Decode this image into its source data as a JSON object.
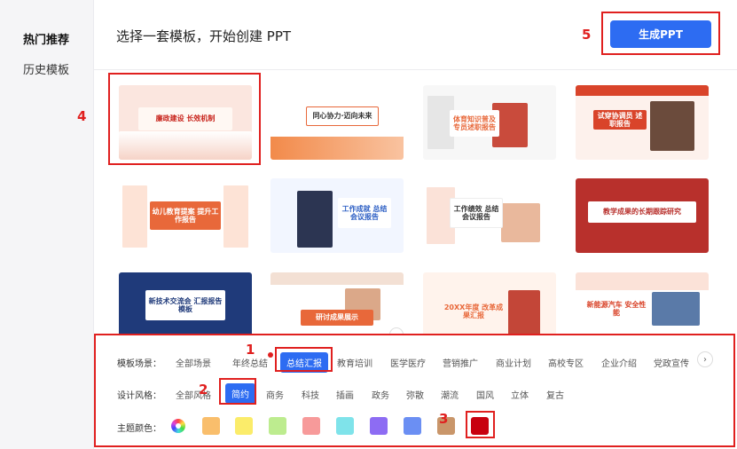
{
  "sidebar": {
    "items": [
      {
        "label": "热门推荐",
        "active": true
      },
      {
        "label": "历史模板",
        "active": false
      }
    ]
  },
  "header": {
    "title": "选择一套模板，开始创建 PPT",
    "generate_label": "生成PPT"
  },
  "annotations": [
    "1",
    "2",
    "3",
    "4",
    "5"
  ],
  "templates": [
    {
      "title": "廉政建设 长效机制",
      "accent": "#c8241c"
    },
    {
      "title": "同心协力·迈向未来",
      "accent": "#e8683a"
    },
    {
      "title": "体育知识普及 专员述职报告",
      "accent": "#e8683a"
    },
    {
      "title": "试穿协调员 述职报告",
      "accent": "#d9442a"
    },
    {
      "title": "幼儿教育提案 提升工作报告",
      "accent": "#e8683a"
    },
    {
      "title": "工作成就 总结会议报告",
      "accent": "#2d5fc4"
    },
    {
      "title": "工作绩效 总结会议报告",
      "accent": "#e8683a"
    },
    {
      "title": "教学成果的长期跟踪研究",
      "accent": "#b8302c"
    },
    {
      "title": "新技术交流会 汇报报告模板",
      "accent": "#1f3a7a"
    },
    {
      "title": "研讨成果展示",
      "accent": "#e8683a"
    },
    {
      "title": "20XX年度 改革成果汇报",
      "accent": "#e8683a"
    },
    {
      "title": "新能源汽车 安全性能",
      "accent": "#d9442a"
    }
  ],
  "filters": {
    "scene": {
      "label": "模板场景：",
      "options": [
        "全部场景",
        "年终总结",
        "总结汇报",
        "教育培训",
        "医学医疗",
        "营销推广",
        "商业计划",
        "高校专区",
        "企业介绍",
        "党政宣传"
      ],
      "selected": "总结汇报"
    },
    "style": {
      "label": "设计风格：",
      "options": [
        "全部风格",
        "简约",
        "商务",
        "科技",
        "插画",
        "政务",
        "弥散",
        "潮流",
        "国风",
        "立体",
        "复古"
      ],
      "selected": "简约"
    },
    "color": {
      "label": "主题颜色：",
      "swatches": [
        "#f9be6c",
        "#fbec6a",
        "#bdec8f",
        "#f79a9a",
        "#7fe3ea",
        "#8d6cf3",
        "#6b8ff3",
        "#c9966a",
        "#c8000f"
      ],
      "selected": "#c8000f"
    }
  }
}
